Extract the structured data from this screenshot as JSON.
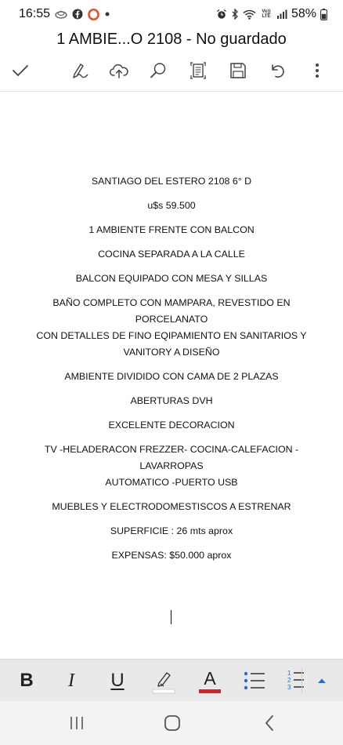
{
  "status_bar": {
    "time": "16:55",
    "battery": "58%",
    "left_icons": [
      "cloud-sync-icon",
      "facebook-icon",
      "opera-icon",
      "dot-icon"
    ],
    "right_icons": [
      "alarm-icon",
      "bluetooth-icon",
      "wifi-icon",
      "volte-icon",
      "signal-icon",
      "battery-icon"
    ],
    "volte_label": "Vo)) LTE"
  },
  "document": {
    "title": "1 AMBIE...O 2108 - No guardado",
    "paragraphs": [
      "SANTIAGO DEL ESTERO 2108 6° D",
      "u$s 59.500",
      "1 AMBIENTE FRENTE CON BALCON",
      "COCINA SEPARADA A LA CALLE",
      "BALCON EQUIPADO CON MESA Y SILLAS",
      "BAÑO COMPLETO CON MAMPARA, REVESTIDO EN PORCELANATO\nCON DETALLES DE FINO EQIPAMIENTO EN SANITARIOS Y\nVANITORY A DISEÑO",
      "AMBIENTE DIVIDIDO CON CAMA DE 2 PLAZAS",
      "ABERTURAS DVH",
      "EXCELENTE DECORACION",
      "TV -HELADERACON FREZZER- COCINA-CALEFACION -LAVARROPAS\nAUTOMATICO -PUERTO USB",
      "MUEBLES Y ELECTRODOMESTISCOS A ESTRENAR",
      "SUPERFICIE : 26 mts aprox",
      "EXPENSAS: $50.000 aprox"
    ]
  },
  "toolbar": {
    "icons": [
      "check-icon",
      "draw-icon",
      "cloud-upload-icon",
      "search-icon",
      "reading-view-icon",
      "save-icon",
      "undo-icon",
      "more-icon"
    ]
  },
  "format_bar": {
    "bold_label": "B",
    "italic_label": "I",
    "underline_label": "U",
    "font_color_label": "A",
    "highlight_color": "#ffffff",
    "font_color": "#e02020",
    "accent_color": "#1f6fd1",
    "numbered_list_digits": [
      "1",
      "2",
      "3"
    ]
  },
  "nav_bar": {
    "icons": [
      "recent-apps-icon",
      "home-icon",
      "back-icon"
    ]
  }
}
